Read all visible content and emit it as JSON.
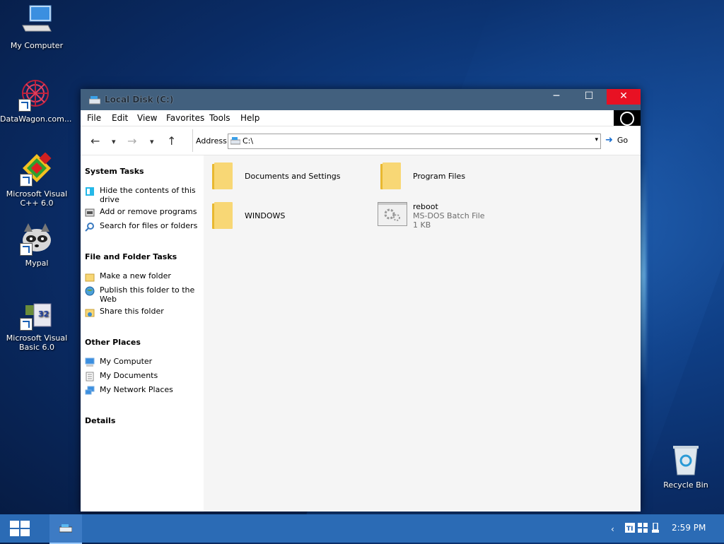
{
  "desktop": {
    "icons": [
      {
        "label": "My Computer",
        "icon": "computer-icon"
      },
      {
        "label": "DataWagon.com...",
        "icon": "datawagon-icon"
      },
      {
        "label": "Microsoft Visual C++ 6.0",
        "icon": "visual-cpp-icon"
      },
      {
        "label": "Mypal",
        "icon": "mypal-raccoon-icon"
      },
      {
        "label": "Microsoft Visual Basic 6.0",
        "icon": "visual-basic-icon"
      },
      {
        "label": "Recycle Bin",
        "icon": "recycle-bin-icon"
      }
    ]
  },
  "window": {
    "title": "Local Disk (C:)",
    "controls": {
      "minimize": "─",
      "maximize": "☐",
      "close": "✕"
    },
    "menu": [
      "File",
      "Edit",
      "View",
      "Favorites",
      "Tools",
      "Help"
    ],
    "toolbar": {
      "back": "←",
      "dropdown": "▾",
      "forward": "→",
      "up": "↑",
      "address_label": "Address",
      "address_value": "C:\\",
      "go_label": "Go"
    }
  },
  "left_pane": {
    "system_tasks": {
      "title": "System Tasks",
      "items": [
        "Hide the contents of this drive",
        "Add or remove programs",
        "Search for files or folders"
      ]
    },
    "file_folder_tasks": {
      "title": "File and Folder Tasks",
      "items": [
        "Make a new folder",
        "Publish this folder to the Web",
        "Share this folder"
      ]
    },
    "other_places": {
      "title": "Other Places",
      "items": [
        "My Computer",
        "My Documents",
        "My Network Places"
      ]
    },
    "details": {
      "title": "Details"
    }
  },
  "content": {
    "items": [
      {
        "name": "Documents and Settings",
        "type": "folder"
      },
      {
        "name": "Program Files",
        "type": "folder"
      },
      {
        "name": "WINDOWS",
        "type": "folder"
      },
      {
        "name": "reboot",
        "type": "MS-DOS Batch File",
        "size": "1 KB"
      }
    ]
  },
  "taskbar": {
    "time": "2:59 PM",
    "tray_chevron": "‹"
  },
  "colors": {
    "titlebar": "#42607e",
    "close": "#e81123",
    "taskbar": "#2b6bb5",
    "folder": "#f8d775"
  }
}
